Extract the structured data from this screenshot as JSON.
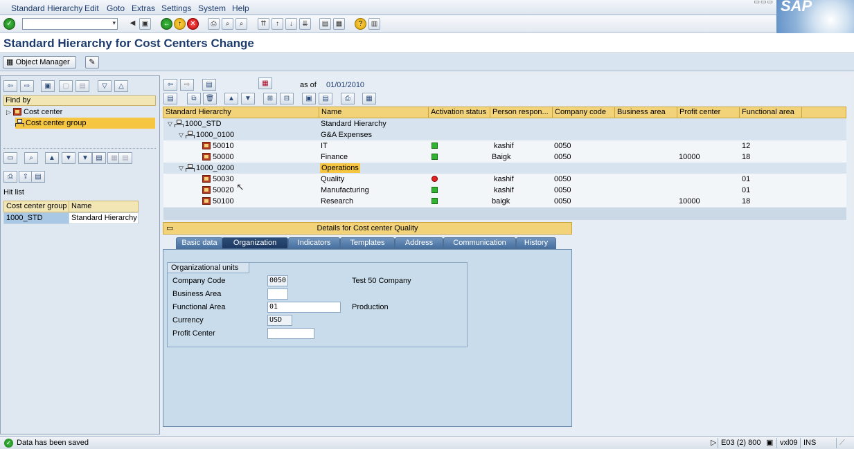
{
  "menu": {
    "items": [
      "Standard Hierarchy",
      "Edit",
      "Goto",
      "Extras",
      "Settings",
      "System",
      "Help"
    ]
  },
  "brand": {
    "logo_text": "SAP"
  },
  "toolbar": {
    "command_field_value": ""
  },
  "title": "Standard Hierarchy for Cost Centers Change",
  "appbar": {
    "object_manager": "Object Manager"
  },
  "left": {
    "find_by": "Find by",
    "tree": [
      {
        "label": "Cost center",
        "selected": false
      },
      {
        "label": "Cost center group",
        "selected": true
      }
    ],
    "hit_list_title": "Hit list",
    "hit_list_headers": [
      "Cost center group",
      "Name"
    ],
    "hit_list_rows": [
      {
        "group": "1000_STD",
        "name": "Standard Hierarchy"
      }
    ]
  },
  "right": {
    "as_of_label": "as of",
    "as_of_date": "01/01/2010",
    "columns": [
      "Standard Hierarchy",
      "Name",
      "Activation status",
      "Person respon...",
      "Company code",
      "Business area",
      "Profit center",
      "Functional area"
    ],
    "rows": [
      {
        "node": "1000_STD",
        "type": "group",
        "level": 0,
        "name": "Standard Hierarchy",
        "status": "",
        "person": "",
        "company": "",
        "profit": "",
        "func": ""
      },
      {
        "node": "1000_0100",
        "type": "group",
        "level": 1,
        "name": "G&A Expenses",
        "status": "",
        "person": "",
        "company": "",
        "profit": "",
        "func": ""
      },
      {
        "node": "50010",
        "type": "cc",
        "level": 2,
        "name": "IT",
        "status": "green",
        "person": "kashif",
        "company": "0050",
        "profit": "",
        "func": "12"
      },
      {
        "node": "50000",
        "type": "cc",
        "level": 2,
        "name": "Finance",
        "status": "green",
        "person": "Baigk",
        "company": "0050",
        "profit": "10000",
        "func": "18"
      },
      {
        "node": "1000_0200",
        "type": "group",
        "level": 1,
        "name": "Operations",
        "status": "",
        "person": "",
        "company": "",
        "profit": "",
        "func": ""
      },
      {
        "node": "50030",
        "type": "cc",
        "level": 2,
        "name": "Quality",
        "status": "red",
        "person": "kashif",
        "company": "0050",
        "profit": "",
        "func": "01"
      },
      {
        "node": "50020",
        "type": "cc",
        "level": 2,
        "name": "Manufacturing",
        "status": "green",
        "person": "kashif",
        "company": "0050",
        "profit": "",
        "func": "01"
      },
      {
        "node": "50100",
        "type": "cc",
        "level": 2,
        "name": "Research",
        "status": "green",
        "person": "baigk",
        "company": "0050",
        "profit": "10000",
        "func": "18"
      }
    ]
  },
  "details": {
    "header": "Details for Cost center Quality",
    "tabs": [
      "Basic data",
      "Organization",
      "Indicators",
      "Templates",
      "Address",
      "Communication",
      "History"
    ],
    "active_tab": "Organization",
    "group_title": "Organizational units",
    "fields": {
      "company_code": {
        "label": "Company Code",
        "value": "0050",
        "desc": "Test 50 Company"
      },
      "business_area": {
        "label": "Business Area",
        "value": ""
      },
      "functional_area": {
        "label": "Functional Area",
        "value": "01",
        "desc": "Production"
      },
      "currency": {
        "label": "Currency",
        "value": "USD"
      },
      "profit_center": {
        "label": "Profit Center",
        "value": ""
      }
    }
  },
  "status": {
    "message": "Data has been saved",
    "system": "E03 (2) 800",
    "server": "vxl09",
    "mode": "INS"
  }
}
